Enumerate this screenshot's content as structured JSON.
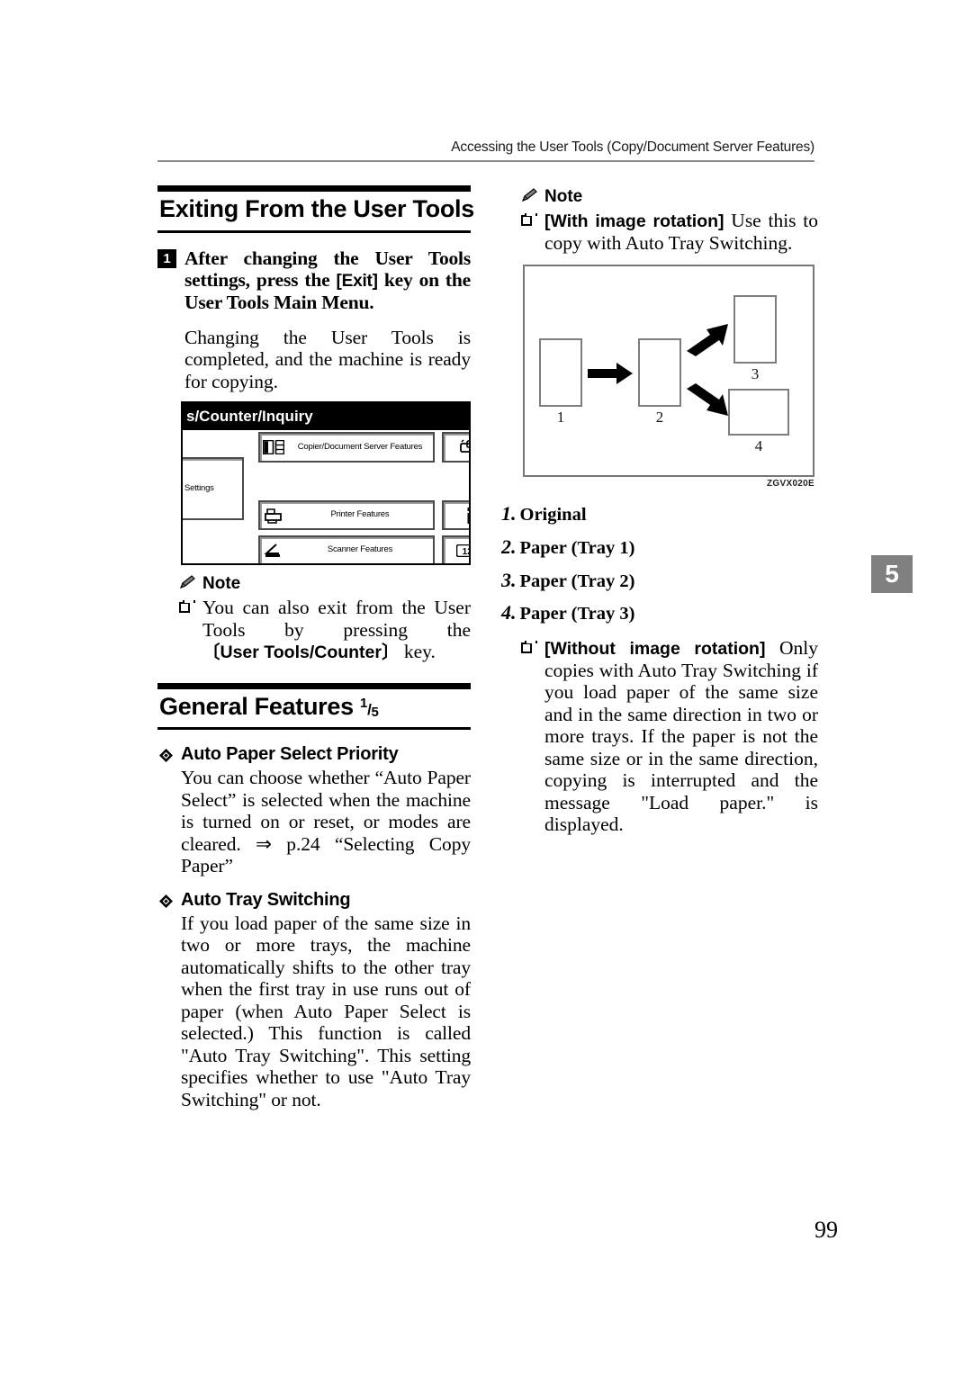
{
  "page": {
    "running_head": "Accessing the User Tools (Copy/Document Server Features)",
    "chapter_tab": "5",
    "folio": "99"
  },
  "left_column": {
    "section1": {
      "title": "Exiting From the User Tools",
      "step": {
        "number": "1",
        "text_before_key": "After changing the User Tools settings, press the ",
        "key": "[Exit]",
        "text_after_key": " key on the User Tools Main Menu."
      },
      "body": "Changing the User Tools is completed, and the machine is ready for copying.",
      "lcd": {
        "title": "s/Counter/Inquiry",
        "system_settings_label": "Settings",
        "copier_label": "Copier/Document Server Features",
        "printer_label": "Printer Features",
        "scanner_label": "Scanner Features",
        "maintenance_icon": "maintenance-icon",
        "inquiry_icon": "information-icon",
        "counter_icon": "counter-123-icon"
      },
      "note": {
        "label": "Note",
        "item_prefix": "You can also exit from the User Tools by pressing the ",
        "item_key": "〔User Tools/Counter〕",
        "item_suffix": " key."
      }
    },
    "section2": {
      "title": "General Features ",
      "fraction_num": "1",
      "fraction_den": "5",
      "features": [
        {
          "heading": "Auto Paper Select Priority",
          "body": "You can choose whether “Auto Paper Select” is selected when the machine is turned on or reset, or modes are cleared. ⇒ p.24 “Selecting Copy Paper”"
        },
        {
          "heading": "Auto Tray Switching",
          "body": "If you load paper of the same size in two or more trays, the machine automatically shifts to the other tray when the first tray in use runs out of paper (when Auto Paper Select is selected.) This function is called \"Auto Tray Switching\". This setting specifies whether to use \"Auto Tray Switching\" or not."
        }
      ]
    }
  },
  "right_column": {
    "note": {
      "label": "Note",
      "item_key": "[With image rotation]",
      "item_text": " Use this to copy with Auto Tray Switching."
    },
    "diagram": {
      "code": "ZGVX020E",
      "sheets": [
        {
          "label": "1",
          "orientation": "portrait"
        },
        {
          "label": "2",
          "orientation": "portrait"
        },
        {
          "label": "3",
          "orientation": "portrait"
        },
        {
          "label": "4",
          "orientation": "landscape"
        }
      ]
    },
    "caption_list": [
      {
        "n": "1.",
        "text": "Original"
      },
      {
        "n": "2.",
        "text": "Paper (Tray 1)"
      },
      {
        "n": "3.",
        "text": "Paper (Tray 2)"
      },
      {
        "n": "4.",
        "text": "Paper (Tray 3)"
      }
    ],
    "note2": {
      "item_key": "[Without image rotation]",
      "item_text": " Only copies with Auto Tray Switching if you load paper of the same size and in the same direction in two or more trays. If the paper is not the same size or in the same direction, copying is interrupted and the message \"Load paper.\" is displayed."
    }
  }
}
